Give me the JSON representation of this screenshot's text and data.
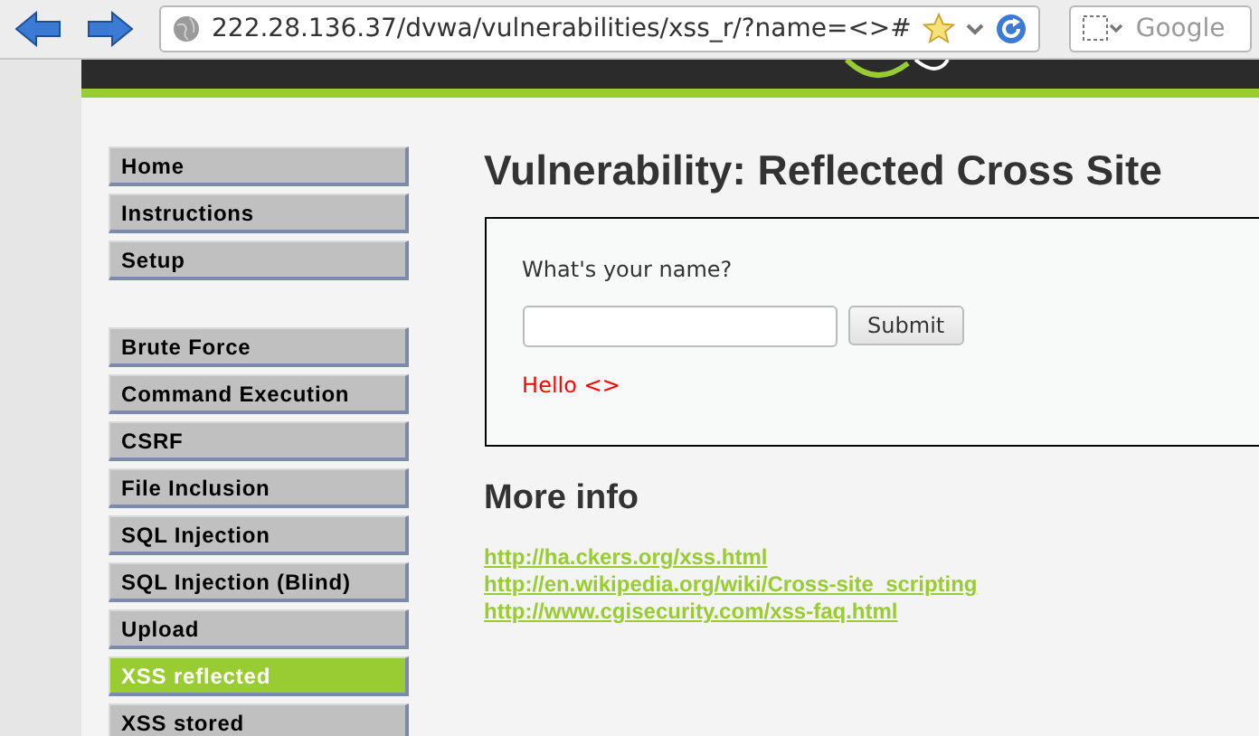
{
  "browser": {
    "url": "222.28.136.37/dvwa/vulnerabilities/xss_r/?name=<>#",
    "search_placeholder": "Google"
  },
  "menu_groups": [
    {
      "items": [
        {
          "label": "Home",
          "selected": false
        },
        {
          "label": "Instructions",
          "selected": false
        },
        {
          "label": "Setup",
          "selected": false
        }
      ]
    },
    {
      "items": [
        {
          "label": "Brute Force",
          "selected": false
        },
        {
          "label": "Command Execution",
          "selected": false
        },
        {
          "label": "CSRF",
          "selected": false
        },
        {
          "label": "File Inclusion",
          "selected": false
        },
        {
          "label": "SQL Injection",
          "selected": false
        },
        {
          "label": "SQL Injection (Blind)",
          "selected": false
        },
        {
          "label": "Upload",
          "selected": false
        },
        {
          "label": "XSS reflected",
          "selected": true
        },
        {
          "label": "XSS stored",
          "selected": false
        }
      ]
    }
  ],
  "title": "Vulnerability: Reflected Cross Site",
  "form": {
    "prompt": "What's your name?",
    "button": "Submit",
    "output": "Hello <>"
  },
  "more_info": {
    "heading": "More info",
    "links": [
      "http://ha.ckers.org/xss.html",
      "http://en.wikipedia.org/wiki/Cross-site_scripting",
      "http://www.cgisecurity.com/xss-faq.html"
    ]
  }
}
